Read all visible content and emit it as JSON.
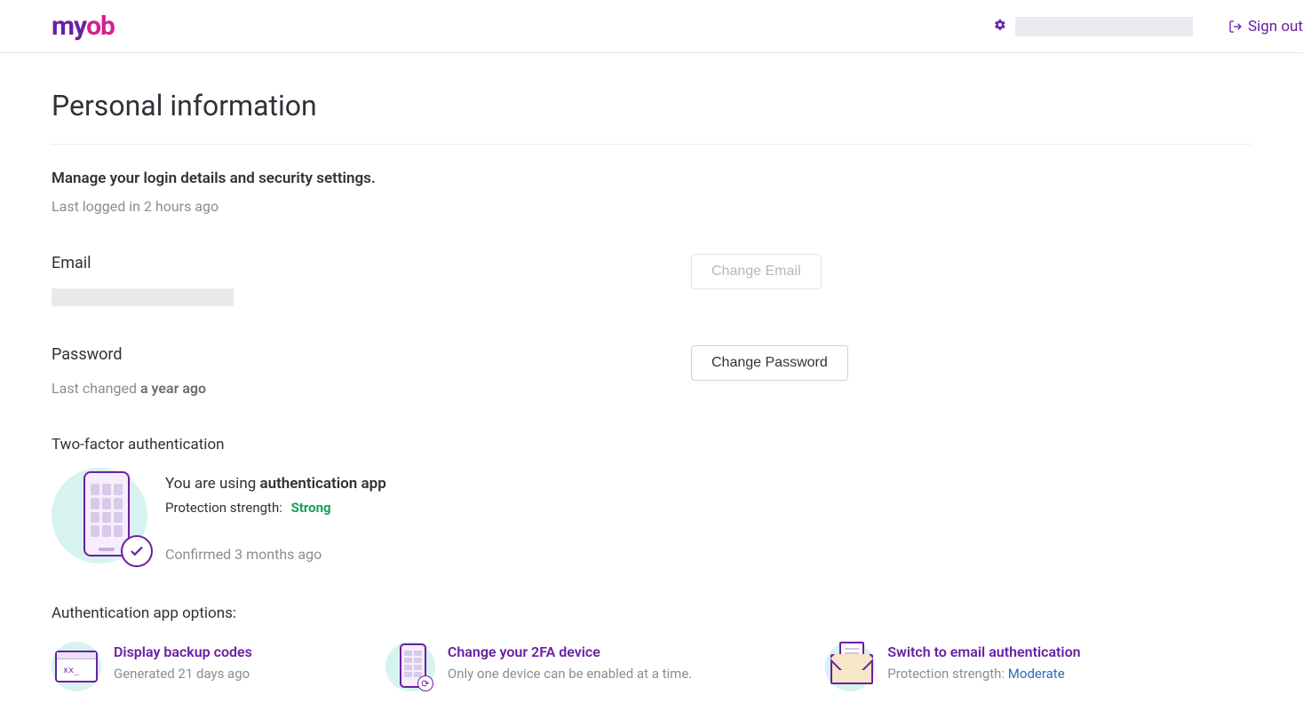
{
  "header": {
    "logo": {
      "m": "m",
      "y": "y",
      "o": "o",
      "b": "b"
    },
    "sign_out": "Sign out"
  },
  "page": {
    "title": "Personal information",
    "subtitle": "Manage your login details and security settings.",
    "last_login_prefix": "Last logged in ",
    "last_login_value": "2 hours ago"
  },
  "email": {
    "label": "Email",
    "change_btn": "Change Email"
  },
  "password": {
    "label": "Password",
    "change_btn": "Change Password",
    "meta_prefix": "Last changed ",
    "meta_value": "a year ago"
  },
  "tfa": {
    "heading": "Two-factor authentication",
    "using_prefix": "You are using ",
    "using_method": "authentication app",
    "strength_label": "Protection strength:",
    "strength_value": "Strong",
    "confirmed_prefix": "Confirmed ",
    "confirmed_value": "3 months ago"
  },
  "options": {
    "heading": "Authentication app options:",
    "items": [
      {
        "title": "Display backup codes",
        "desc_prefix": "Generated ",
        "desc_value": "21 days ago",
        "desc_link": ""
      },
      {
        "title": "Change your 2FA device",
        "desc_prefix": "Only one device can be enabled at a time.",
        "desc_value": "",
        "desc_link": ""
      },
      {
        "title": "Switch to email authentication",
        "desc_prefix": "Protection strength: ",
        "desc_value": "",
        "desc_link": "Moderate"
      }
    ]
  }
}
